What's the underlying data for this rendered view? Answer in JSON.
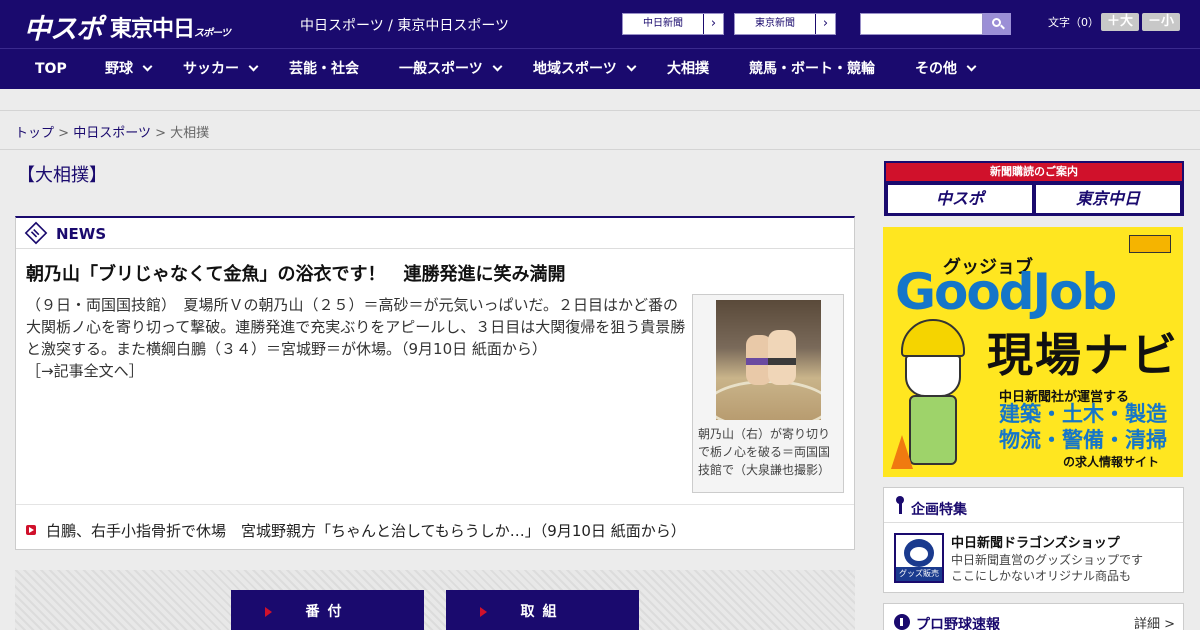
{
  "header": {
    "logo_main": "中スポ",
    "logo_tokyo": "東京中日",
    "logo_tokyo_small": "スポーツ",
    "site_title": "中日スポーツ / 東京中日スポーツ",
    "paper_links": [
      {
        "label": "中日新聞"
      },
      {
        "label": "東京新聞"
      }
    ],
    "search_placeholder": "",
    "font_size_label": "文字（0）",
    "font_plus": "＋大",
    "font_minus": "－小"
  },
  "nav": {
    "items": [
      {
        "label": "TOP"
      },
      {
        "label": "野球"
      },
      {
        "label": "サッカー"
      },
      {
        "label": "芸能・社会"
      },
      {
        "label": "一般スポーツ"
      },
      {
        "label": "地域スポーツ"
      },
      {
        "label": "大相撲"
      },
      {
        "label": "競馬・ボート・競輪"
      },
      {
        "label": "その他"
      }
    ]
  },
  "breadcrumb": {
    "top": "トップ",
    "sep": ">",
    "chunichi": "中日スポーツ",
    "current": "大相撲"
  },
  "page_title": "【大相撲】",
  "news": {
    "label": "NEWS",
    "headline": "朝乃山「ブリじゃなくて金魚」の浴衣です！　連勝発進に笑み満開",
    "body": "（９日・両国国技館）　夏場所Ｖの朝乃山（２５）＝高砂＝が元気いっぱいだ。２日目はかど番の大関栃ノ心を寄り切って撃破。連勝発進で充実ぶりをアピールし、３日目は大関復帰を狙う貴景勝と激突する。また横綱白鵬（３４）＝宮城野＝が休場。（9月10日 紙面から）",
    "more_link": "［→記事全文へ］",
    "photo_caption": "朝乃山（右）が寄り切りで栃ノ心を破る＝両国国技館で（大泉謙也撮影）",
    "sub_headline": "白鵬、右手小指骨折で休場　宮城野親方「ちゃんと治してもらうしか…」（9月10日 紙面から）"
  },
  "buttons": [
    {
      "label": "番付"
    },
    {
      "label": "取組"
    }
  ],
  "sidebar": {
    "subscribe_title": "新聞購読のご案内",
    "subscribe_left": "中スポ",
    "subscribe_right": "東京中日",
    "goodjob": {
      "kana": "グッジョブ",
      "brand": "GoodJob",
      "navi": "現場ナビ",
      "operator": "中日新聞社が運営する",
      "fields_1": "建築・土木・製造",
      "fields_2": "物流・警備・清掃",
      "tagline": "の求人情報サイト"
    },
    "feature": {
      "title": "企画特集",
      "thumb_label": "グッズ販売中",
      "shop_title": "中日新聞ドラゴンズショップ",
      "shop_desc_1": "中日新聞直営のグッズショップです",
      "shop_desc_2": "ここにしかないオリジナル商品も"
    },
    "baseball": {
      "title": "プロ野球速報",
      "more": "詳細 >"
    }
  }
}
